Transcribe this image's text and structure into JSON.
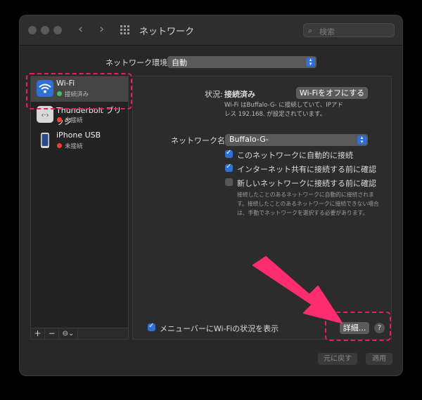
{
  "window": {
    "title": "ネットワーク"
  },
  "search": {
    "placeholder": "検索"
  },
  "location": {
    "label": "ネットワーク環境:",
    "value": "自動"
  },
  "sidebar": {
    "services": [
      {
        "name": "Wi-Fi",
        "status": "接続済み",
        "status_color": "#34c759",
        "icon": "wifi-icon"
      },
      {
        "name": "Thunderbolt ブリッジ",
        "status": "未接続",
        "status_color": "#ff3b30",
        "icon": "thunderbolt-bridge-icon"
      },
      {
        "name": "iPhone USB",
        "status": "未接続",
        "status_color": "#ff3b30",
        "icon": "iphone-icon"
      }
    ],
    "add": "+",
    "remove": "−",
    "action": "⊖⌄"
  },
  "wifi": {
    "status_label": "状況:",
    "status_value": "接続済み",
    "turn_off_button": "Wi-Fiをオフにする",
    "status_desc_line1": "Wi-Fi はBuffalo-G-   に接続していて、IPアド",
    "status_desc_line2": "レス 192.168.   が設定されています。",
    "network_name_label": "ネットワーク名:",
    "network_name_value": "Buffalo-G-",
    "options": [
      {
        "label": "このネットワークに自動的に接続",
        "checked": true
      },
      {
        "label": "インターネット共有に接続する前に確認",
        "checked": true
      },
      {
        "label": "新しいネットワークに接続する前に確認",
        "checked": false
      }
    ],
    "desc_line1": "接続したことのあるネットワークに自動的に接続されま",
    "desc_line2": "す。接続したことのあるネットワークに接続できない場合",
    "desc_line3": "は、手動でネットワークを選択する必要があります。",
    "menubar_checkbox": "メニューバーにWi-Fiの状況を表示",
    "advanced_button": "詳細...",
    "help": "?"
  },
  "footer": {
    "revert": "元に戻す",
    "apply": "適用"
  },
  "colors": {
    "accent": "#2f6fd6",
    "highlight": "#e91e63",
    "connected": "#34c759",
    "disconnected": "#ff3b30"
  }
}
